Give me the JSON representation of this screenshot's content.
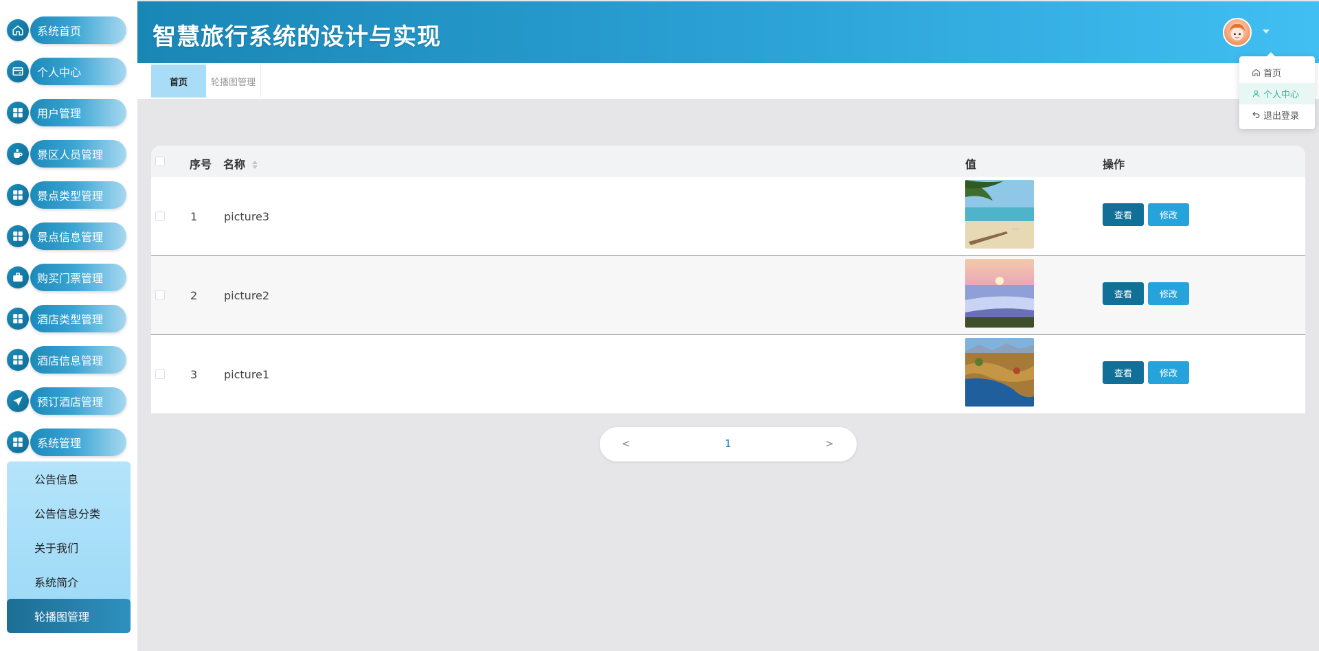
{
  "header": {
    "title": "智慧旅行系统的设计与实现"
  },
  "sidebar": {
    "items": [
      {
        "label": "系统首页",
        "icon": "home-icon"
      },
      {
        "label": "个人中心",
        "icon": "wallet-icon"
      },
      {
        "label": "用户管理",
        "icon": "grid-icon"
      },
      {
        "label": "景区人员管理",
        "icon": "coffee-icon"
      },
      {
        "label": "景点类型管理",
        "icon": "grid-icon"
      },
      {
        "label": "景点信息管理",
        "icon": "grid-icon"
      },
      {
        "label": "购买门票管理",
        "icon": "briefcase-icon"
      },
      {
        "label": "酒店类型管理",
        "icon": "grid-icon"
      },
      {
        "label": "酒店信息管理",
        "icon": "grid-icon"
      },
      {
        "label": "预订酒店管理",
        "icon": "send-icon"
      },
      {
        "label": "系统管理",
        "icon": "grid-icon"
      }
    ],
    "submenu": [
      {
        "label": "公告信息"
      },
      {
        "label": "公告信息分类"
      },
      {
        "label": "关于我们"
      },
      {
        "label": "系统简介"
      },
      {
        "label": "轮播图管理",
        "active": true
      }
    ]
  },
  "tabs": [
    {
      "label": "首页",
      "active": true
    },
    {
      "label": "轮播图管理"
    }
  ],
  "dropdown": {
    "items": [
      {
        "label": "首页",
        "icon": "home-icon"
      },
      {
        "label": "个人中心",
        "icon": "user-icon",
        "hover": true
      },
      {
        "label": "退出登录",
        "icon": "back-arrow-icon"
      }
    ]
  },
  "table": {
    "columns": {
      "index": "序号",
      "name": "名称",
      "value": "值",
      "actions": "操作"
    },
    "rows": [
      {
        "index": "1",
        "name": "picture3",
        "image": "beach"
      },
      {
        "index": "2",
        "name": "picture2",
        "image": "waterfall"
      },
      {
        "index": "3",
        "name": "picture1",
        "image": "lake"
      }
    ],
    "view_label": "查看",
    "edit_label": "修改"
  },
  "pagination": {
    "prev": "<",
    "current": "1",
    "next": ">"
  },
  "colors": {
    "header_start": "#1987b6",
    "header_end": "#41bff2",
    "view_button": "#126f97",
    "edit_button": "#27a3dc",
    "active_tab": "#a9dcf7"
  }
}
